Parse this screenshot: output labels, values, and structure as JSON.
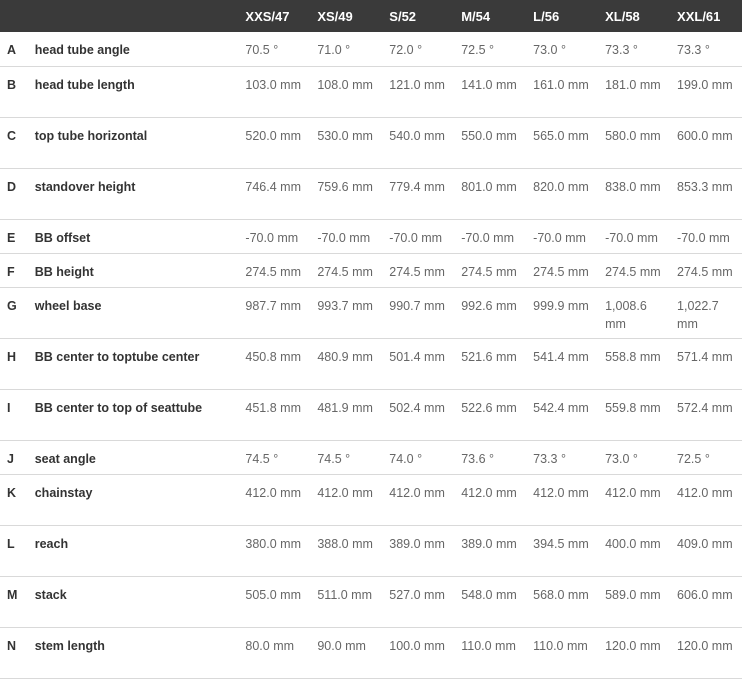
{
  "header": {
    "letter": "",
    "label": "",
    "sizes": [
      "XXS/47",
      "XS/49",
      "S/52",
      "M/54",
      "L/56",
      "XL/58",
      "XXL/61"
    ]
  },
  "rows": [
    {
      "letter": "A",
      "label": "head tube angle",
      "values": [
        "70.5 °",
        "71.0 °",
        "72.0 °",
        "72.5 °",
        "73.0 °",
        "73.3 °",
        "73.3 °"
      ]
    },
    {
      "letter": "B",
      "label": "head tube length",
      "values": [
        "103.0 mm",
        "108.0 mm",
        "121.0 mm",
        "141.0 mm",
        "161.0 mm",
        "181.0 mm",
        "199.0 mm"
      ]
    },
    {
      "letter": "C",
      "label": "top tube horizontal",
      "values": [
        "520.0 mm",
        "530.0 mm",
        "540.0 mm",
        "550.0 mm",
        "565.0 mm",
        "580.0 mm",
        "600.0 mm"
      ]
    },
    {
      "letter": "D",
      "label": "standover height",
      "values": [
        "746.4 mm",
        "759.6 mm",
        "779.4 mm",
        "801.0 mm",
        "820.0 mm",
        "838.0 mm",
        "853.3 mm"
      ]
    },
    {
      "letter": "E",
      "label": "BB offset",
      "values": [
        "-70.0 mm",
        "-70.0 mm",
        "-70.0 mm",
        "-70.0 mm",
        "-70.0 mm",
        "-70.0 mm",
        "-70.0 mm"
      ]
    },
    {
      "letter": "F",
      "label": "BB height",
      "values": [
        "274.5 mm",
        "274.5 mm",
        "274.5 mm",
        "274.5 mm",
        "274.5 mm",
        "274.5 mm",
        "274.5 mm"
      ]
    },
    {
      "letter": "G",
      "label": "wheel base",
      "values": [
        "987.7 mm",
        "993.7 mm",
        "990.7 mm",
        "992.6 mm",
        "999.9 mm",
        "1,008.6 mm",
        "1,022.7 mm"
      ]
    },
    {
      "letter": "H",
      "label": "BB center to toptube center",
      "values": [
        "450.8 mm",
        "480.9 mm",
        "501.4 mm",
        "521.6 mm",
        "541.4 mm",
        "558.8 mm",
        "571.4 mm"
      ]
    },
    {
      "letter": "I",
      "label": "BB center to top of seattube",
      "values": [
        "451.8 mm",
        "481.9 mm",
        "502.4 mm",
        "522.6 mm",
        "542.4 mm",
        "559.8 mm",
        "572.4 mm"
      ]
    },
    {
      "letter": "J",
      "label": "seat angle",
      "values": [
        "74.5 °",
        "74.5 °",
        "74.0 °",
        "73.6 °",
        "73.3 °",
        "73.0 °",
        "72.5 °"
      ]
    },
    {
      "letter": "K",
      "label": "chainstay",
      "values": [
        "412.0 mm",
        "412.0 mm",
        "412.0 mm",
        "412.0 mm",
        "412.0 mm",
        "412.0 mm",
        "412.0 mm"
      ]
    },
    {
      "letter": "L",
      "label": "reach",
      "values": [
        "380.0 mm",
        "388.0 mm",
        "389.0 mm",
        "389.0 mm",
        "394.5 mm",
        "400.0 mm",
        "409.0 mm"
      ]
    },
    {
      "letter": "M",
      "label": "stack",
      "values": [
        "505.0 mm",
        "511.0 mm",
        "527.0 mm",
        "548.0 mm",
        "568.0 mm",
        "589.0 mm",
        "606.0 mm"
      ]
    },
    {
      "letter": "N",
      "label": "stem length",
      "values": [
        "80.0 mm",
        "90.0 mm",
        "100.0 mm",
        "110.0 mm",
        "110.0 mm",
        "120.0 mm",
        "120.0 mm"
      ]
    }
  ]
}
